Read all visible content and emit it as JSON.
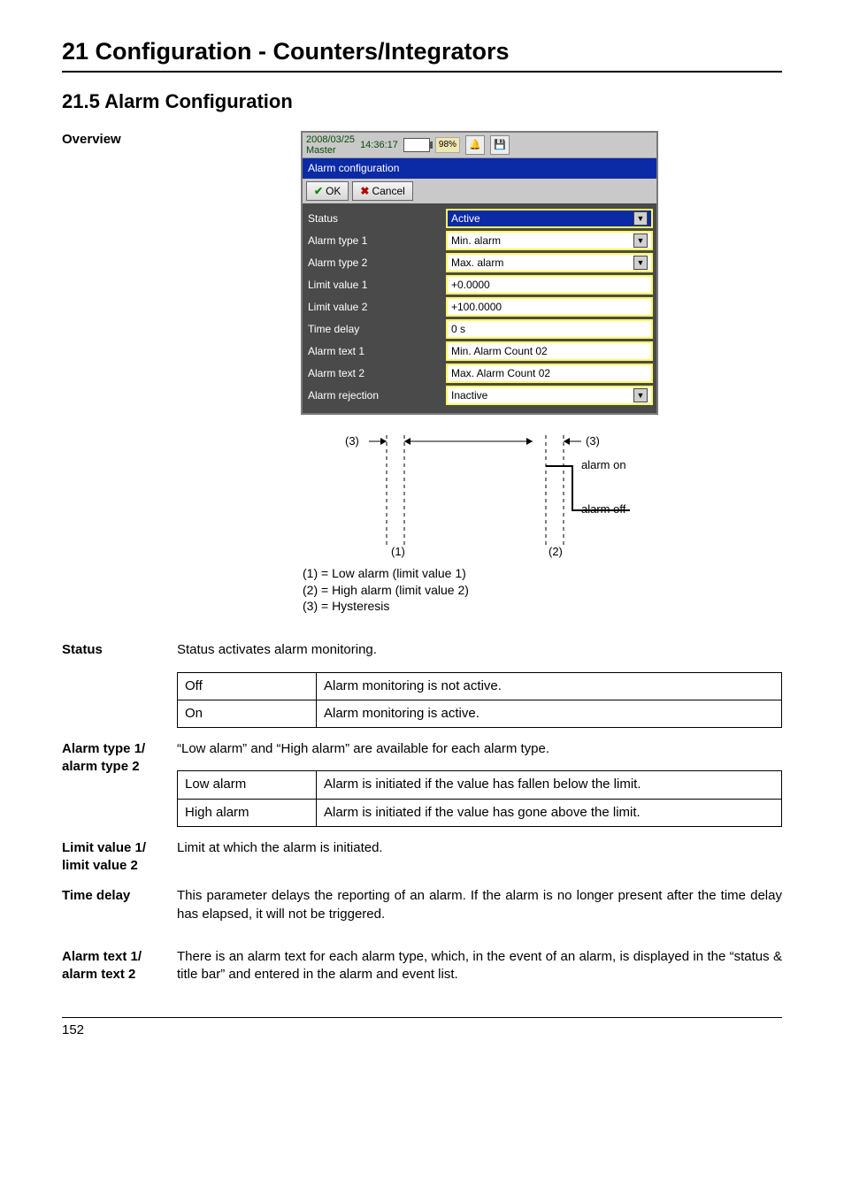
{
  "chapter_title": "21 Configuration - Counters/Integrators",
  "section_title": "21.5   Alarm Configuration",
  "overview_label": "Overview",
  "screenshot": {
    "date": "2008/03/25",
    "time": "14:36:17",
    "master": "Master",
    "percent": "98%",
    "title": "Alarm configuration",
    "ok": "OK",
    "cancel": "Cancel",
    "rows": [
      {
        "label": "Status",
        "value": "Active",
        "dd": true,
        "sel": true
      },
      {
        "label": "Alarm type 1",
        "value": "Min. alarm",
        "dd": true,
        "sel": false
      },
      {
        "label": "Alarm type 2",
        "value": "Max. alarm",
        "dd": true,
        "sel": false
      },
      {
        "label": "Limit value 1",
        "value": "+0.0000",
        "dd": false,
        "sel": false
      },
      {
        "label": "Limit value 2",
        "value": "+100.0000",
        "dd": false,
        "sel": false
      },
      {
        "label": "Time delay",
        "value": "0 s",
        "dd": false,
        "sel": false
      },
      {
        "label": "Alarm text 1",
        "value": "Min. Alarm Count 02",
        "dd": false,
        "sel": false
      },
      {
        "label": "Alarm text 2",
        "value": "Max. Alarm Count 02",
        "dd": false,
        "sel": false
      },
      {
        "label": "Alarm rejection",
        "value": "Inactive",
        "dd": true,
        "sel": false
      }
    ]
  },
  "diagram": {
    "left3": "(3)",
    "right3": "(3)",
    "alarm_on": "alarm on",
    "alarm_off": "alarm off",
    "m1": "(1)",
    "m2": "(2)",
    "caption1": "(1) = Low alarm (limit value 1)",
    "caption2": "(2) = High alarm (limit value 2)",
    "caption3": "(3) = Hysteresis"
  },
  "status": {
    "label": "Status",
    "intro": "Status activates alarm monitoring.",
    "r1k": "Off",
    "r1v": "Alarm monitoring is not active.",
    "r2k": "On",
    "r2v": "Alarm monitoring is active."
  },
  "alarm_type": {
    "label1": "Alarm type 1/",
    "label2": "alarm type 2",
    "intro": "“Low alarm” and “High alarm” are available for each alarm type.",
    "r1k": "Low alarm",
    "r1v": "Alarm is initiated if the value has fallen below the limit.",
    "r2k": "High alarm",
    "r2v": "Alarm is initiated if the value has gone above the limit."
  },
  "limit": {
    "label1": "Limit value 1/",
    "label2": "limit value 2",
    "text": "Limit at which the alarm is initiated."
  },
  "timedelay": {
    "label": "Time delay",
    "text": "This parameter delays the reporting of an alarm. If the alarm is no longer present after the time delay has elapsed, it will not be triggered."
  },
  "alarmtext": {
    "label1": "Alarm text 1/",
    "label2": "alarm text 2",
    "text": "There is an alarm text for each alarm type, which, in the event of an alarm, is displayed in the “status & title bar” and entered in the alarm and event list."
  },
  "page_no": "152"
}
